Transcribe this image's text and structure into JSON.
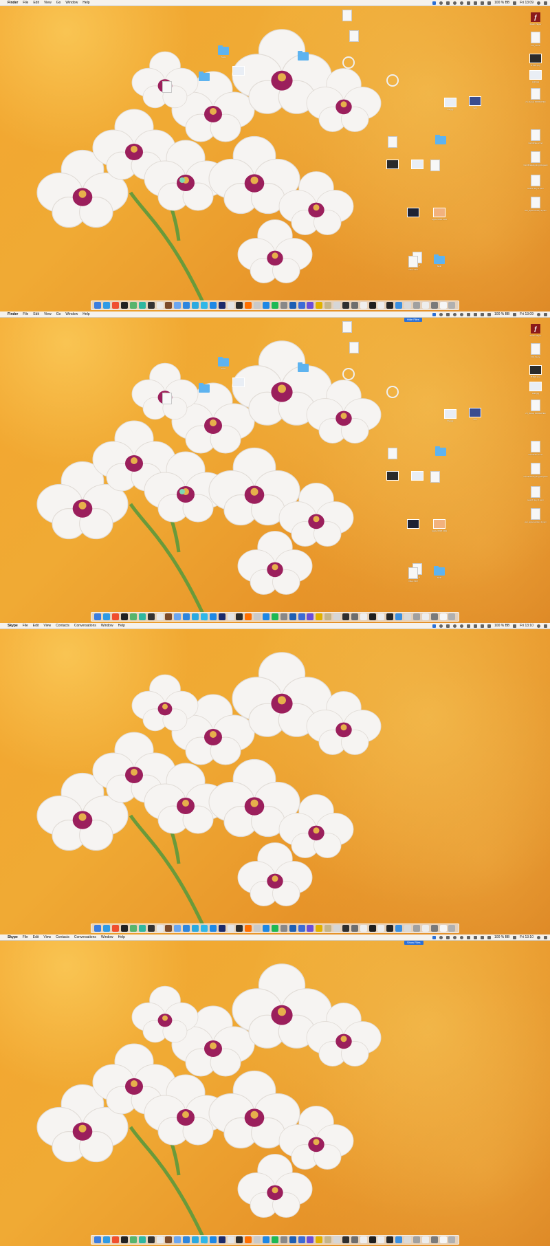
{
  "panels": [
    {
      "menubar": {
        "app_name": "Finder",
        "menus": [
          "File",
          "Edit",
          "View",
          "Go",
          "Window",
          "Help"
        ],
        "battery": "100 % BB",
        "clock": "Fri 13:09"
      },
      "tooltip": "",
      "show_desktop_icons": true
    },
    {
      "menubar": {
        "app_name": "Finder",
        "menus": [
          "File",
          "Edit",
          "View",
          "Go",
          "Window",
          "Help"
        ],
        "battery": "100 % BB",
        "clock": "Fri 13:09"
      },
      "tooltip": "Hide Files",
      "show_desktop_icons": true
    },
    {
      "menubar": {
        "app_name": "Skype",
        "menus": [
          "File",
          "Edit",
          "View",
          "Contacts",
          "Conversations",
          "Window",
          "Help"
        ],
        "battery": "100 % BB",
        "clock": "Fri 13:10"
      },
      "tooltip": "",
      "show_desktop_icons": false
    },
    {
      "menubar": {
        "app_name": "Skype",
        "menus": [
          "File",
          "Edit",
          "View",
          "Contacts",
          "Conversations",
          "Window",
          "Help"
        ],
        "battery": "100 % BB",
        "clock": "Fri 13:10"
      },
      "tooltip": "Show Files",
      "show_desktop_icons": false
    }
  ],
  "desktop_icons": {
    "right_column": [
      {
        "type": "flash",
        "label": "Flash Player"
      },
      {
        "type": "doc",
        "label": "DS_Store"
      },
      {
        "type": "img",
        "label": "BTNP.png"
      },
      {
        "type": "img",
        "label": "Hdd.jpg"
      },
      {
        "type": "doc",
        "label": "ch_Setup 00000A7E4"
      },
      {
        "type": "doc",
        "label": "Certificate 2.cer"
      },
      {
        "type": "doc",
        "label": "Certificatesigning Request"
      },
      {
        "type": "doc",
        "label": "search key 2.pem"
      },
      {
        "type": "doc",
        "label": "ven_apserverkey 2.pem"
      }
    ],
    "scattered": [
      {
        "type": "doc",
        "label": ""
      },
      {
        "type": "folder",
        "label": "Tools"
      },
      {
        "type": "folder",
        "label": ""
      },
      {
        "type": "img",
        "label": ""
      },
      {
        "type": "folder",
        "label": ""
      },
      {
        "type": "doc",
        "label": ""
      },
      {
        "type": "gear",
        "label": ""
      },
      {
        "type": "gear",
        "label": ""
      },
      {
        "type": "img",
        "label": "file.jpg"
      },
      {
        "type": "img",
        "label": "test"
      },
      {
        "type": "doc",
        "label": ""
      },
      {
        "type": "folder",
        "label": ""
      },
      {
        "type": "img",
        "label": ""
      },
      {
        "type": "img",
        "label": ""
      },
      {
        "type": "doc",
        "label": ""
      },
      {
        "type": "img",
        "label": ""
      },
      {
        "type": "img",
        "label": "Apple 0018 1RH"
      },
      {
        "type": "doc",
        "label": "test.js"
      },
      {
        "type": "doc",
        "label": "index.html"
      },
      {
        "type": "folder",
        "label": "build"
      },
      {
        "type": "doc",
        "label": ""
      }
    ]
  },
  "dock_items": [
    "#3b7ee0",
    "#2f9be5",
    "#f04f2e",
    "#222222",
    "#57b46c",
    "#2fb7a0",
    "#333333",
    "#e9e9e9",
    "#7b4a2a",
    "#6aa6f0",
    "#2e86de",
    "#2aa9e0",
    "#2fb7e8",
    "#1e88e5",
    "#1b2a6b",
    "#e4e4e4",
    "#2c2c2c",
    "#ff6f00",
    "#c9c9c9",
    "#1e88e5",
    "#1db954",
    "#888888",
    "#1e5fb3",
    "#3c6bd6",
    "#6b4ed8",
    "#e1b200",
    "#c4b48a",
    "#d6d6d6",
    "#2f2f2f",
    "#6e6e6e",
    "#efefef",
    "#1f1f1f",
    "#ededed",
    "#262626",
    "#3a8fe0",
    "#dadada",
    "#a0a0a0",
    "#ededed",
    "#7a7a7a",
    "#f6f6f6",
    "#b0b0b0"
  ]
}
